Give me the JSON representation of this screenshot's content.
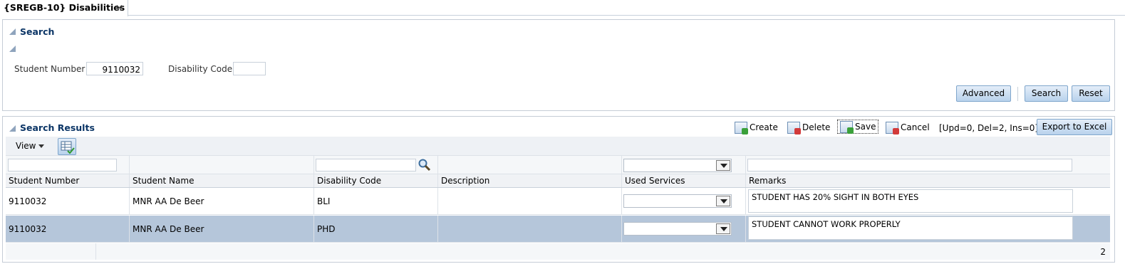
{
  "tab": {
    "title": "{SREGB-10} Disabilities",
    "close_glyph": "×"
  },
  "search": {
    "title": "Search",
    "student_number_label": "Student Number",
    "student_number_value": "9110032",
    "disability_code_label": "Disability Code",
    "disability_code_value": "",
    "advanced_label": "Advanced",
    "search_label": "Search",
    "reset_label": "Reset"
  },
  "results": {
    "title": "Search Results",
    "toolbar": {
      "create": "Create",
      "delete": "Delete",
      "save": "Save",
      "cancel": "Cancel",
      "counter": "[Upd=0, Del=2, Ins=0]",
      "export": "Export to Excel"
    },
    "view_label": "View",
    "columns": [
      "Student Number",
      "Student Name",
      "Disability Code",
      "Description",
      "Used Services",
      "Remarks"
    ],
    "rows": [
      {
        "student_number": "9110032",
        "student_name": "MNR AA De Beer",
        "disability_code": "BLI",
        "description": "",
        "used_services": "",
        "remarks": "STUDENT HAS 20% SIGHT IN BOTH EYES",
        "selected": false
      },
      {
        "student_number": "9110032",
        "student_name": "MNR AA De Beer",
        "disability_code": "PHD",
        "description": "",
        "used_services": "",
        "remarks": "STUDENT CANNOT WORK PROPERLY",
        "selected": true
      }
    ],
    "row_count": "2"
  },
  "colors": {
    "accent": "#0b3566",
    "selected_row": "#b5c6da",
    "button_border": "#7fa6cc"
  },
  "icons": [
    "close-icon",
    "collapse-icon",
    "create-icon",
    "delete-icon",
    "save-icon",
    "cancel-icon",
    "detach-icon",
    "search-icon",
    "dropdown-icon"
  ]
}
